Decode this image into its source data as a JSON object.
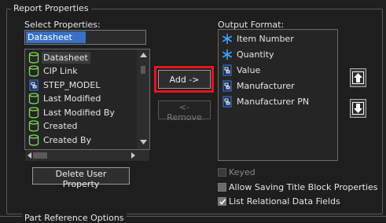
{
  "group": {
    "title": "Report Properties"
  },
  "select_properties": {
    "label": "Select Properties:",
    "filter_value": "Datasheet",
    "items": [
      {
        "label": "Datasheet",
        "icon": "database-cylinder-icon",
        "selected": true
      },
      {
        "label": "CIP Link",
        "icon": "database-cylinder-icon"
      },
      {
        "label": "STEP_MODEL",
        "icon": "document-field-icon"
      },
      {
        "label": "Last Modified",
        "icon": "database-cylinder-icon"
      },
      {
        "label": "Last Modified By",
        "icon": "database-cylinder-icon"
      },
      {
        "label": "Created",
        "icon": "database-cylinder-icon"
      },
      {
        "label": "Created By",
        "icon": "database-cylinder-icon"
      }
    ],
    "delete_button": "Delete User Property"
  },
  "buttons": {
    "add": "Add ->",
    "remove": "<- Remove"
  },
  "output_format": {
    "label": "Output Format:",
    "items": [
      {
        "label": "Item Number",
        "icon": "asterisk-icon"
      },
      {
        "label": "Quantity",
        "icon": "asterisk-icon"
      },
      {
        "label": "Value",
        "icon": "document-field-icon"
      },
      {
        "label": "Manufacturer",
        "icon": "document-field-icon"
      },
      {
        "label": "Manufacturer PN",
        "icon": "document-field-icon"
      }
    ]
  },
  "options": {
    "keyed": {
      "label": "Keyed",
      "checked": false,
      "enabled": false
    },
    "allow_saving": {
      "label": "Allow Saving Title Block Properties",
      "checked": false,
      "enabled": true
    },
    "list_relational": {
      "label": "List Relational Data Fields",
      "checked": true,
      "enabled": true
    }
  },
  "next_group": {
    "title": "Part Reference Options"
  },
  "colors": {
    "highlight_border": "#e8141c",
    "cylinder_green": "#7ed957",
    "asterisk_blue": "#3da3ff",
    "doc_blue": "#3b7de0"
  }
}
